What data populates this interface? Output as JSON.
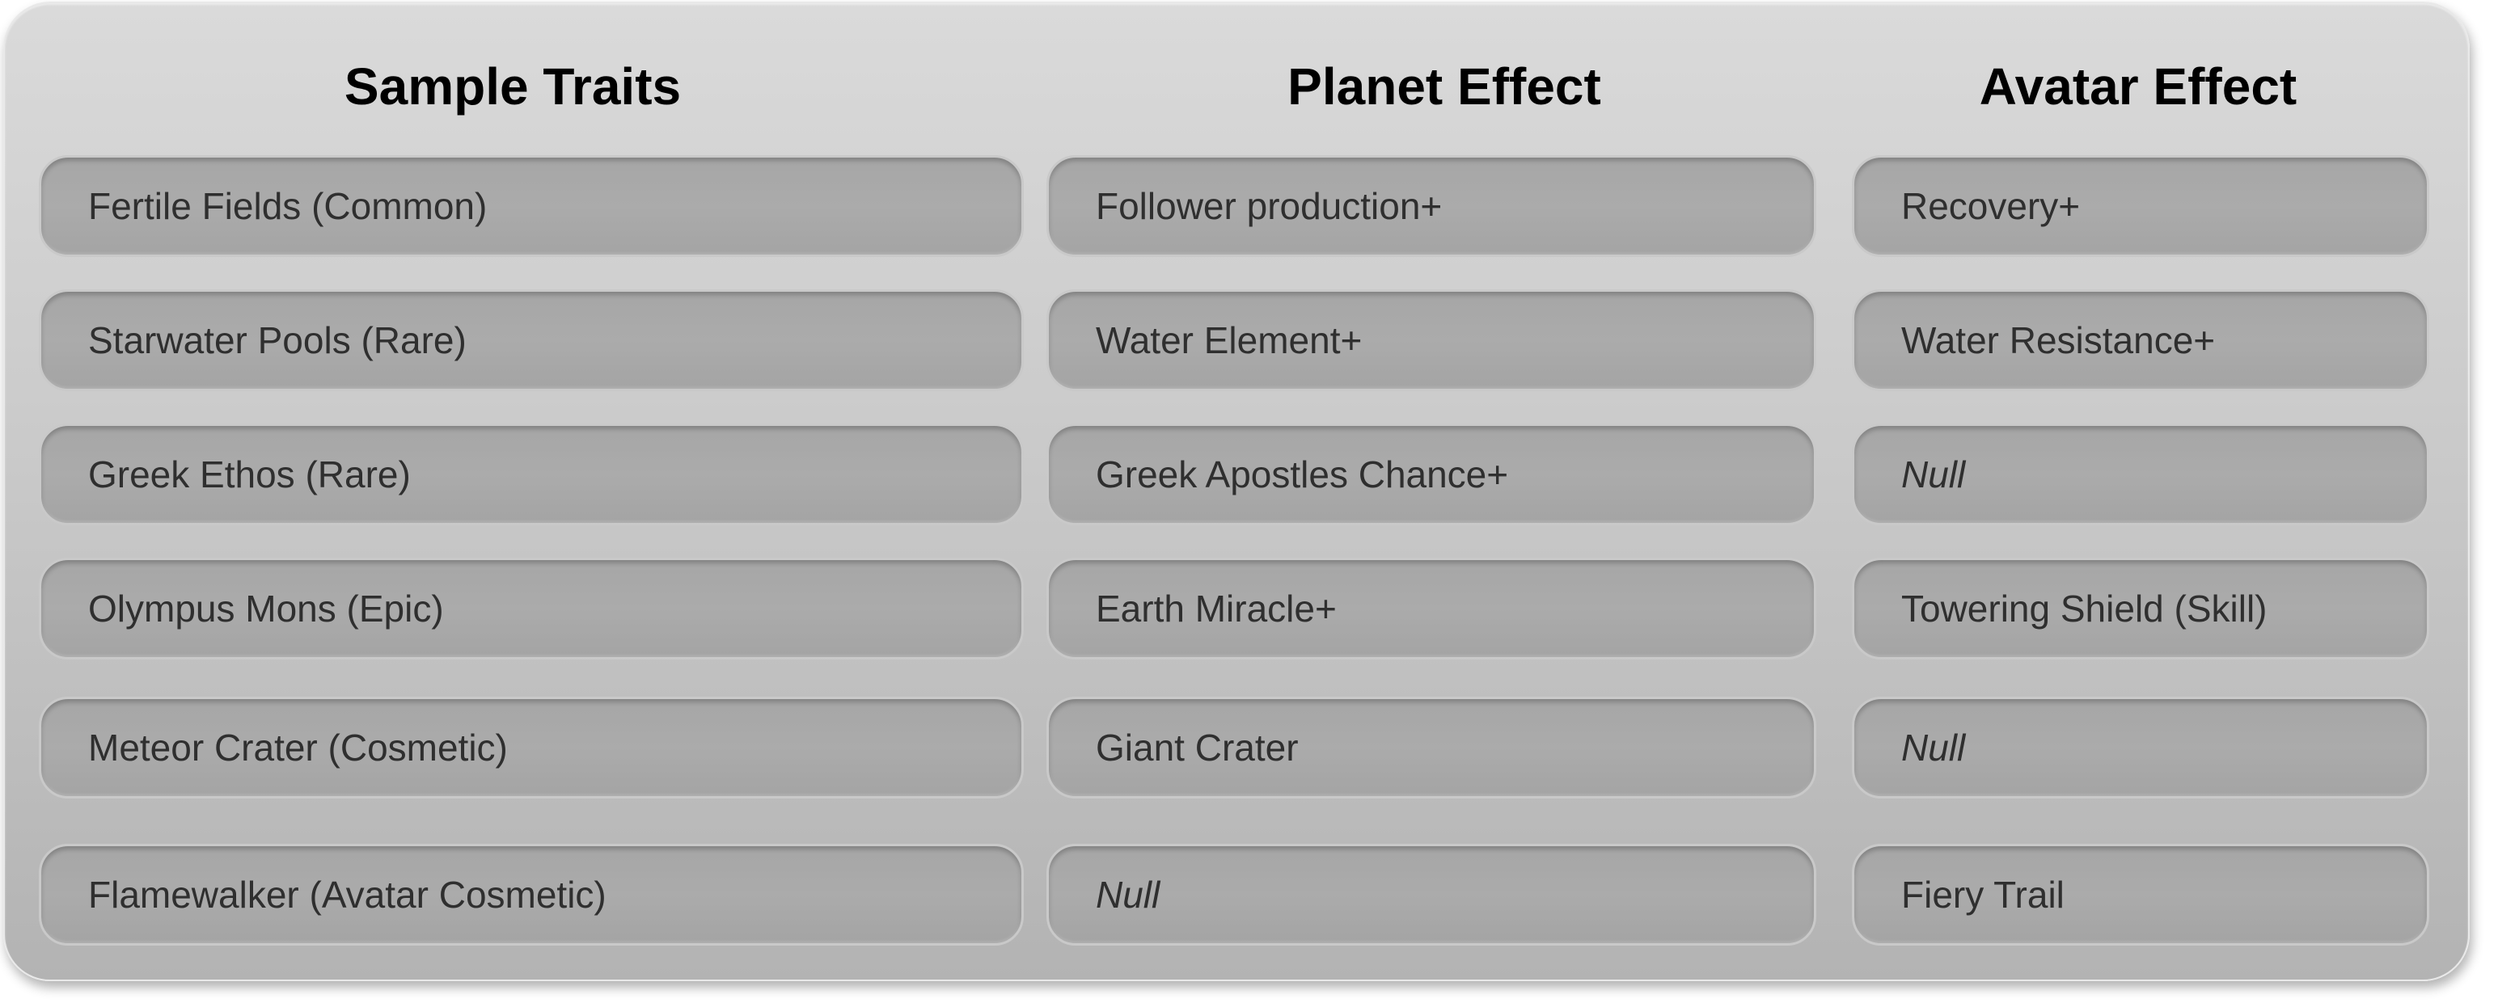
{
  "headers": [
    "Sample Traits",
    "Planet Effect",
    "Avatar Effect"
  ],
  "rows": [
    [
      "Fertile Fields (Common)",
      "Follower production+",
      "Recovery+"
    ],
    [
      "Starwater Pools (Rare)",
      "Water Element+",
      "Water Resistance+"
    ],
    [
      "Greek Ethos (Rare)",
      "Greek Apostles Chance+",
      "Null"
    ],
    [
      "Olympus Mons (Epic)",
      "Earth Miracle+",
      "Towering Shield (Skill)"
    ],
    [
      "Meteor Crater (Cosmetic)",
      "Giant Crater",
      "Null"
    ],
    [
      "Flamewalker (Avatar Cosmetic)",
      "Null",
      "Fiery Trail"
    ]
  ],
  "colors": {
    "panel_top": "#dadada",
    "panel_bottom": "#b3b3b3",
    "cell_fill": "#a8a8a8",
    "cell_text": "#2f2f2f",
    "header_text": "#000000"
  }
}
